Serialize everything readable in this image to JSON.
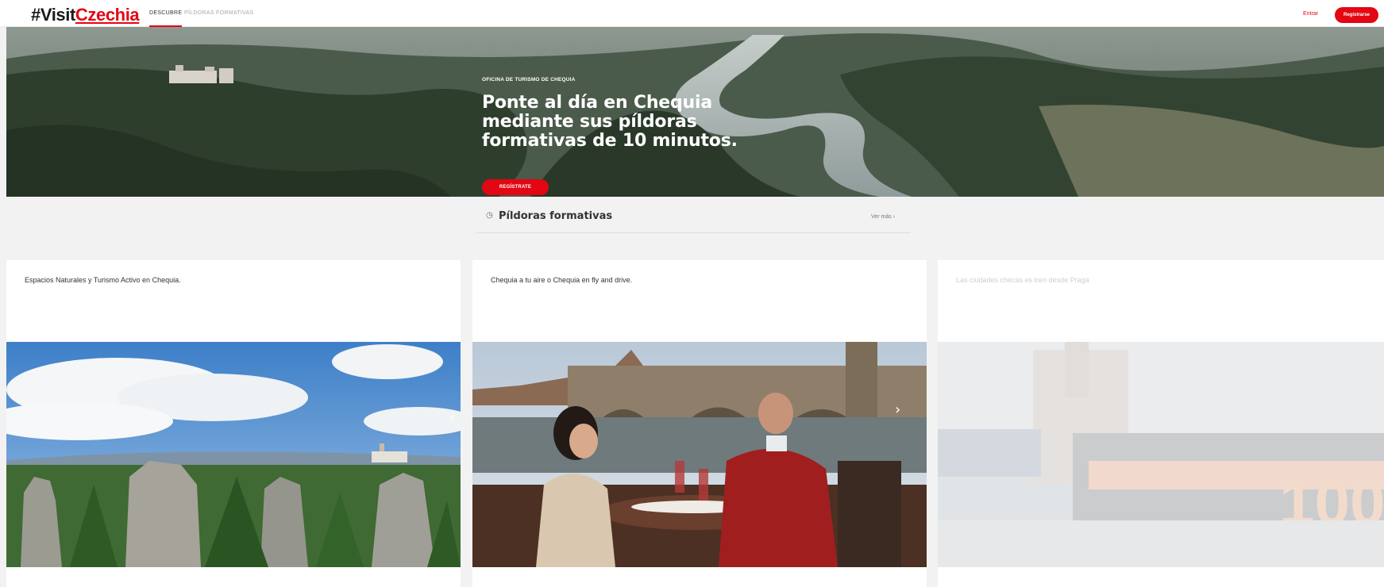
{
  "nav": {
    "logo_prefix": "#Visit",
    "logo_brand": "Czechia",
    "tabs": [
      {
        "label": "DESCUBRE",
        "active": true
      },
      {
        "label": "PÍLDORAS FORMATIVAS",
        "active": false
      }
    ],
    "login_label": "Entrar",
    "register_label": "Regístrarse"
  },
  "hero": {
    "eyebrow": "OFICINA DE TURISMO DE CHEQUIA",
    "title": "Ponte al día en Chequia mediante sus píldoras formativas de 10 minutos.",
    "cta_label": "REGÍSTRATE"
  },
  "section": {
    "icon": "clock-icon",
    "title": "Píldoras formativas",
    "more_label": "Ver más ›"
  },
  "cards": [
    {
      "title": "Espacios Naturales y Turismo Activo en Chequia."
    },
    {
      "title": "Chequia a tu aire o Chequia en fly and drive."
    },
    {
      "title": "Las ciudades checas es tren desde Praga"
    }
  ],
  "carousel": {
    "prev_icon": "chevron-left-icon",
    "next_icon": "chevron-right-icon",
    "prev_glyph": "‹",
    "next_glyph": "›"
  },
  "colors": {
    "accent": "#e30613",
    "background": "#f2f2f2"
  }
}
